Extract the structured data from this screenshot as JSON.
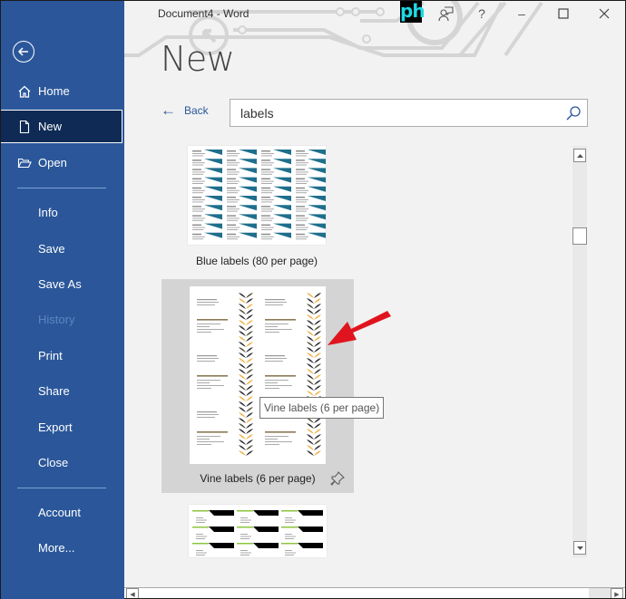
{
  "window": {
    "title": "Document4  -  Word",
    "controls": {
      "app_logo_text": "ph",
      "coauthor_icon": "person-feedback-icon",
      "help": "?",
      "minimize": "–",
      "maximize": "☐",
      "close": "✕"
    }
  },
  "sidebar": {
    "back_icon": "back-arrow-circle-icon",
    "items": [
      {
        "label": "Home",
        "icon": "home-icon",
        "state": "normal"
      },
      {
        "label": "New",
        "icon": "new-document-icon",
        "state": "active"
      },
      {
        "label": "Open",
        "icon": "folder-open-icon",
        "state": "normal"
      },
      {
        "label": "Info",
        "state": "normal"
      },
      {
        "label": "Save",
        "state": "normal"
      },
      {
        "label": "Save As",
        "state": "normal"
      },
      {
        "label": "History",
        "state": "disabled"
      },
      {
        "label": "Print",
        "state": "normal"
      },
      {
        "label": "Share",
        "state": "normal"
      },
      {
        "label": "Export",
        "state": "normal"
      },
      {
        "label": "Close",
        "state": "normal"
      },
      {
        "label": "Account",
        "state": "normal"
      },
      {
        "label": "More...",
        "state": "normal"
      }
    ]
  },
  "main": {
    "heading": "New",
    "back_label": "Back",
    "search": {
      "value": "labels",
      "placeholder": ""
    },
    "templates": [
      {
        "label": "Blue labels (80 per page)",
        "hovered": false
      },
      {
        "label": "Vine labels (6 per page)",
        "hovered": true
      },
      {
        "label": "",
        "hovered": false
      }
    ],
    "tooltip": "Vine labels (6 per page)",
    "colors": {
      "accent": "#2b579a",
      "active_nav": "#0f2a55",
      "annotation_arrow": "#e0141e",
      "vine_dark": "#2e3034",
      "vine_gold": "#f0b24a",
      "vine_olive": "#54503a"
    }
  }
}
